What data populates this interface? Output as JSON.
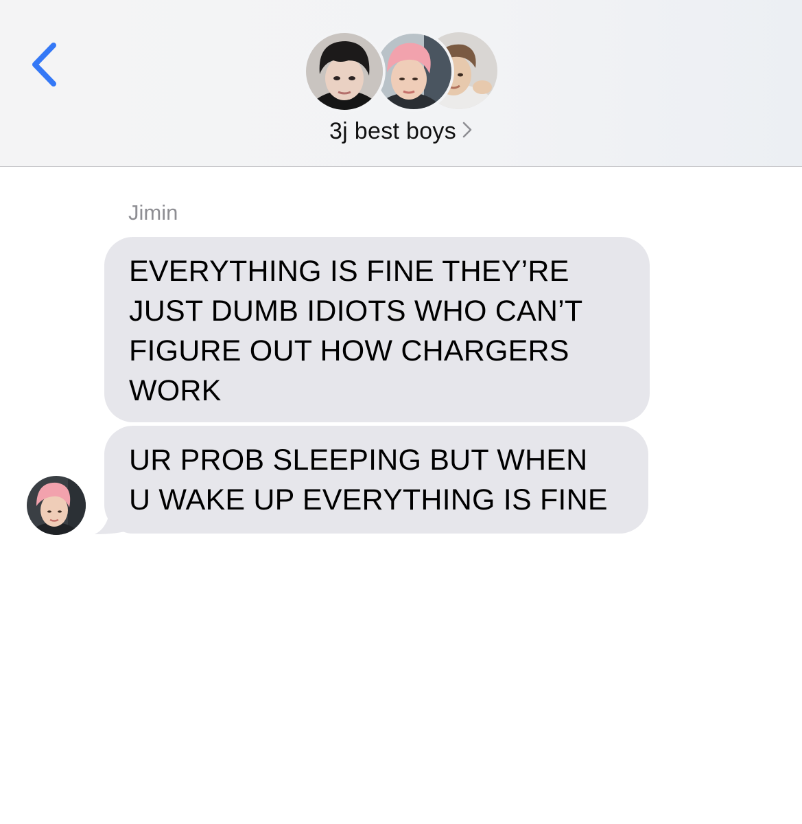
{
  "header": {
    "back_icon": "chevron-left-icon",
    "group_name": "3j best boys",
    "detail_icon": "chevron-right-icon",
    "avatars": [
      "avatar-dark-hair",
      "avatar-pink-hair",
      "avatar-brown-hair"
    ]
  },
  "conversation": {
    "sender": "Jimin",
    "messages": [
      {
        "text": "EVERYTHING IS FINE THEY’RE\nJUST DUMB IDIOTS WHO CAN’T\nFIGURE OUT HOW CHARGERS\nWORK"
      },
      {
        "text": "UR PROB SLEEPING BUT WHEN\nU WAKE UP EVERYTHING IS FINE"
      }
    ]
  },
  "colors": {
    "accent": "#3478f6",
    "bubble_bg": "#e6e6eb",
    "secondary_text": "#8e8e93"
  }
}
